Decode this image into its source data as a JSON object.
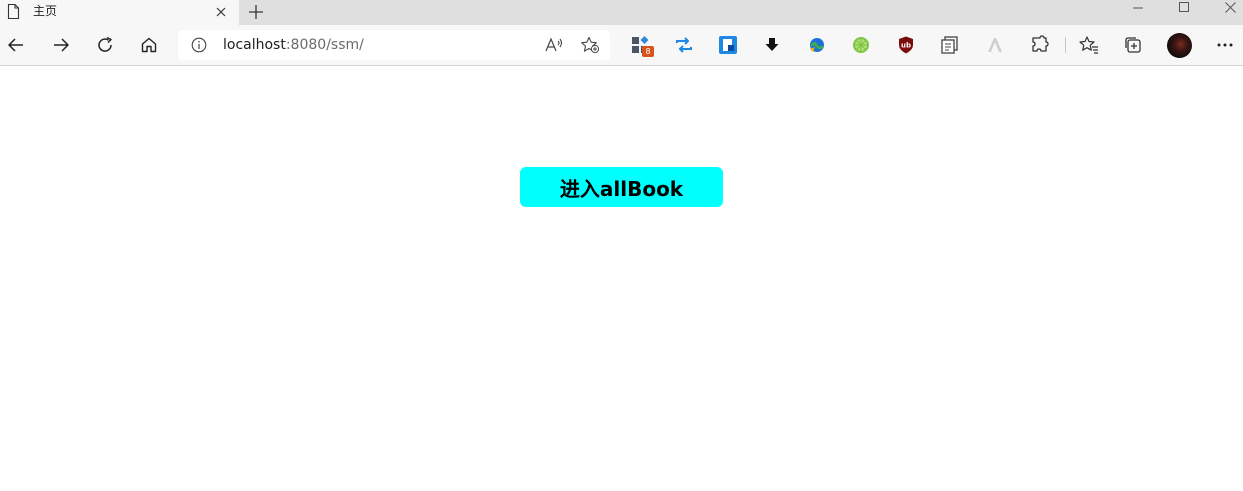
{
  "tab": {
    "title": "主页"
  },
  "address_bar": {
    "host": "localhost",
    "rest": ":8080/ssm/"
  },
  "extensions": {
    "badge_count": "8"
  },
  "page": {
    "enter_button_label": "进入allBook",
    "enter_button_color": "#00ffff"
  },
  "icons": [
    "page-icon",
    "close-icon",
    "plus-icon",
    "minimize-icon",
    "maximize-icon",
    "window-close-icon",
    "back-arrow-icon",
    "forward-arrow-icon",
    "reload-icon",
    "home-icon",
    "info-icon",
    "read-aloud-icon",
    "add-favorite-icon",
    "extension-icon",
    "favorites-icon",
    "collections-icon",
    "profile-avatar",
    "more-icon"
  ]
}
